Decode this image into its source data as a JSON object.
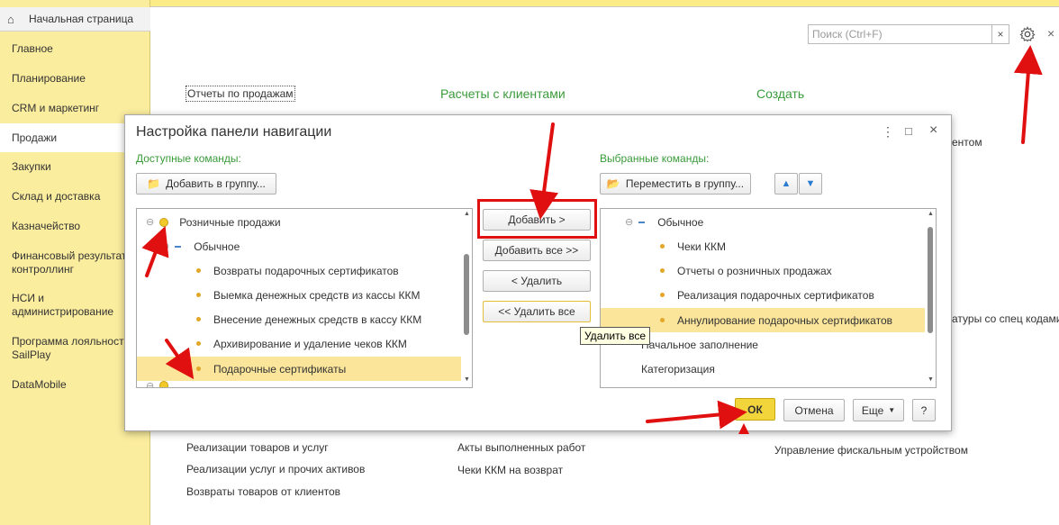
{
  "colors": {
    "sidebar_bg": "#fbed9e",
    "accent_green": "#3a9b3a",
    "selection": "#fbe59b",
    "ok_button": "#f2d53a",
    "annotation_red": "#e01010"
  },
  "home_tab": {
    "label": "Начальная страница",
    "icon": "home-icon"
  },
  "sidebar": {
    "items": [
      {
        "label": "Главное"
      },
      {
        "label": "Планирование"
      },
      {
        "label": "CRM и маркетинг"
      },
      {
        "label": "Продажи"
      },
      {
        "label": "Закупки"
      },
      {
        "label": "Склад и доставка"
      },
      {
        "label": "Казначейство"
      },
      {
        "label": "Финансовый результат и контроллинг"
      },
      {
        "label": "НСИ и администрирование"
      },
      {
        "label": "Программа лояльности SailPlay"
      },
      {
        "label": "DataMobile"
      }
    ]
  },
  "toolbar": {
    "search_placeholder": "Поиск (Ctrl+F)",
    "clear_label": "×",
    "close_label": "×"
  },
  "background": {
    "sales_reports_link": "Отчеты по продажам",
    "col2_heading": "Расчеты с клиентами",
    "col3_heading": "Создать",
    "partial_right_1": "ентом",
    "partial_right_2": "атуры со спец кодами",
    "bottom_col1": [
      "Реализации товаров и услуг",
      "Реализации услуг и прочих активов",
      "Возвраты товаров от клиентов"
    ],
    "bottom_col2": [
      "Акты выполненных работ",
      "Чеки ККМ на возврат"
    ],
    "bottom_col3": [
      "Управление фискальным устройством"
    ]
  },
  "dialog": {
    "title": "Настройка панели навигации",
    "more_label": "⋮",
    "maximize_label": "□",
    "close_label": "×",
    "available_label": "Доступные команды:",
    "selected_label": "Выбранные команды:",
    "add_to_group": "Добавить в группу...",
    "move_to_group": "Переместить в группу...",
    "available_list": [
      {
        "label": "Розничные продажи",
        "level": 0,
        "marker": "group",
        "selected": false
      },
      {
        "label": "Обычное",
        "level": 1,
        "marker": "dash",
        "selected": false
      },
      {
        "label": "Возвраты подарочных сертификатов",
        "level": 2,
        "marker": "dot",
        "selected": false
      },
      {
        "label": "Выемка денежных средств из кассы ККМ",
        "level": 2,
        "marker": "dot",
        "selected": false
      },
      {
        "label": "Внесение денежных средств в кассу ККМ",
        "level": 2,
        "marker": "dot",
        "selected": false
      },
      {
        "label": "Архивирование и удаление чеков ККМ",
        "level": 2,
        "marker": "dot",
        "selected": false
      },
      {
        "label": "Подарочные сертификаты",
        "level": 2,
        "marker": "dot",
        "selected": true
      }
    ],
    "selected_list": [
      {
        "label": "Обычное",
        "level": 1,
        "marker": "dash",
        "selected": false
      },
      {
        "label": "Чеки ККМ",
        "level": 2,
        "marker": "dot",
        "selected": false
      },
      {
        "label": "Отчеты о розничных продажах",
        "level": 2,
        "marker": "dot",
        "selected": false
      },
      {
        "label": "Реализация подарочных сертификатов",
        "level": 2,
        "marker": "dot",
        "selected": false
      },
      {
        "label": "Аннулирование подарочных сертификатов",
        "level": 2,
        "marker": "dot",
        "selected": true
      },
      {
        "label": "Начальное заполнение",
        "level": 1,
        "marker": "none",
        "selected": false
      },
      {
        "label": "Категоризация",
        "level": 1,
        "marker": "none",
        "selected": false
      }
    ],
    "middle_buttons": {
      "add": "Добавить >",
      "add_all": "Добавить все >>",
      "remove": "< Удалить",
      "remove_all": "<< Удалить все"
    },
    "tooltip": "Удалить все",
    "footer": {
      "ok": "ОК",
      "cancel": "Отмена",
      "more": "Еще",
      "help": "?"
    }
  }
}
